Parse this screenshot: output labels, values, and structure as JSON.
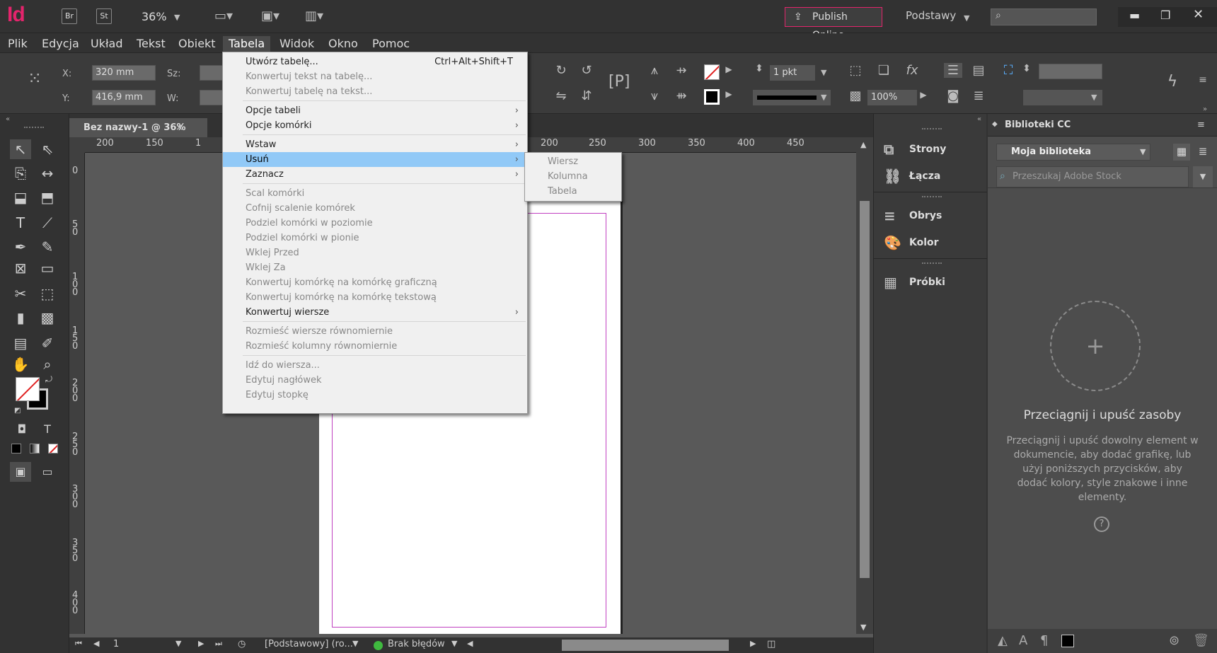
{
  "app": {
    "logo": "Id",
    "br": "Br",
    "st": "St",
    "zoom": "36%",
    "publish": "Publish Online",
    "workspace": "Podstawy"
  },
  "menubar": [
    "Plik",
    "Edycja",
    "Układ",
    "Tekst",
    "Obiekt",
    "Tabela",
    "Widok",
    "Okno",
    "Pomoc"
  ],
  "control": {
    "x_label": "X:",
    "y_label": "Y:",
    "x_value": "320 mm",
    "y_value": "416,9 mm",
    "w_label": "Sz:",
    "h_label": "W:",
    "stroke_weight": "1 pkt",
    "opacity": "100%"
  },
  "document": {
    "tab_title": "Bez nazwy-1 @ 36%",
    "close": "×",
    "ruler_h": [
      "200",
      "150",
      "1",
      "200",
      "250",
      "300",
      "350",
      "400",
      "450"
    ],
    "ruler_v": [
      "0",
      "5\n0",
      "1\n0\n0",
      "1\n5\n0",
      "2\n0\n0",
      "2\n5\n0",
      "3\n0\n0",
      "3\n5\n0",
      "4\n0\n0"
    ]
  },
  "status": {
    "page": "1",
    "style": "[Podstawowy] (ro...",
    "errors": "Brak błędów"
  },
  "panels": [
    {
      "label": "Strony",
      "icon": "pages-icon"
    },
    {
      "label": "Łącza",
      "icon": "links-icon"
    },
    {
      "label": "Obrys",
      "icon": "stroke-icon"
    },
    {
      "label": "Kolor",
      "icon": "color-icon"
    },
    {
      "label": "Próbki",
      "icon": "swatches-icon"
    }
  ],
  "cc": {
    "title": "Biblioteki CC",
    "library": "Moja biblioteka",
    "search_placeholder": "Przeszukaj Adobe Stock",
    "drop_title": "Przeciągnij i upuść zasoby",
    "drop_text": "Przeciągnij i upuść dowolny element w dokumencie, aby dodać grafikę, lub użyj poniższych przycisków, aby dodać kolory, style znakowe i inne elementy.",
    "help": "?"
  },
  "menu": {
    "items": [
      {
        "label": "Utwórz tabelę...",
        "shortcut": "Ctrl+Alt+Shift+T",
        "enabled": true
      },
      {
        "label": "Konwertuj tekst na tabelę...",
        "enabled": false
      },
      {
        "label": "Konwertuj tabelę na tekst...",
        "enabled": false
      },
      {
        "label": "Opcje tabeli",
        "enabled": true,
        "submenu": true
      },
      {
        "label": "Opcje komórki",
        "enabled": true,
        "submenu": true
      },
      {
        "label": "Wstaw",
        "enabled": true,
        "submenu": true
      },
      {
        "label": "Usuń",
        "enabled": true,
        "submenu": true,
        "highlighted": true
      },
      {
        "label": "Zaznacz",
        "enabled": true,
        "submenu": true
      },
      {
        "label": "Scal komórki",
        "enabled": false
      },
      {
        "label": "Cofnij scalenie komórek",
        "enabled": false
      },
      {
        "label": "Podziel komórki w poziomie",
        "enabled": false
      },
      {
        "label": "Podziel komórki w pionie",
        "enabled": false
      },
      {
        "label": "Wklej Przed",
        "enabled": false
      },
      {
        "label": "Wklej Za",
        "enabled": false
      },
      {
        "label": "Konwertuj komórkę na komórkę graficzną",
        "enabled": false
      },
      {
        "label": "Konwertuj komórkę na komórkę tekstową",
        "enabled": false
      },
      {
        "label": "Konwertuj wiersze",
        "enabled": true,
        "submenu": true
      },
      {
        "label": "Rozmieść wiersze równomiernie",
        "enabled": false
      },
      {
        "label": "Rozmieść kolumny równomiernie",
        "enabled": false
      },
      {
        "label": "Idź do wiersza...",
        "enabled": false
      },
      {
        "label": "Edytuj nagłówek",
        "enabled": false
      },
      {
        "label": "Edytuj stopkę",
        "enabled": false
      }
    ],
    "submenu": [
      "Wiersz",
      "Kolumna",
      "Tabela"
    ]
  },
  "colors": {
    "accent": "#e4246c",
    "highlight": "#91c9f7"
  }
}
